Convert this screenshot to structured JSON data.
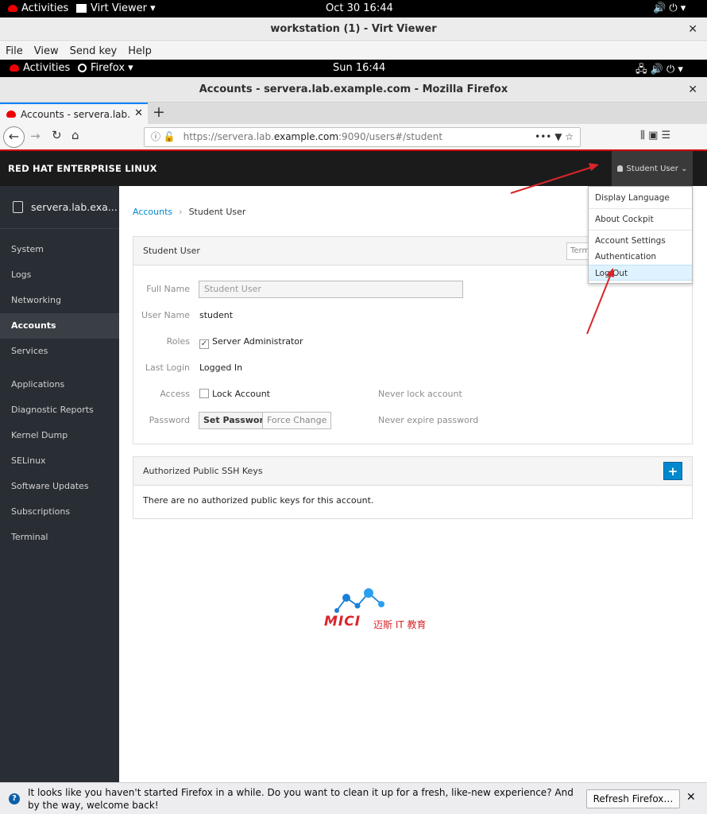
{
  "outer_bar": {
    "activities": "Activities",
    "app_menu": "Virt Viewer ▾",
    "clock": "Oct 30  16:44",
    "status_icons": "🔊  ⏻ ▾"
  },
  "virt_viewer": {
    "title": "workstation (1) - Virt Viewer",
    "close": "✕",
    "menu": [
      "File",
      "View",
      "Send key",
      "Help"
    ]
  },
  "inner_bar": {
    "activities": "Activities",
    "app_menu": "Firefox ▾",
    "clock": "Sun 16:44",
    "status_icons": "🖧  🔊  ⏻ ▾"
  },
  "firefox": {
    "title": "Accounts - servera.lab.example.com - Mozilla Firefox",
    "close": "✕",
    "tab_label": "Accounts - servera.lab.example.com",
    "tab_close": "✕",
    "new_tab": "+",
    "url_prefix": "https://servera.lab.",
    "url_host": "example.com",
    "url_suffix": ":9090/users#/student",
    "url_actions": "•••  ▼  ☆",
    "toolbar_right": "⫼  ▣  ☰"
  },
  "cockpit": {
    "brand": "RED HAT ENTERPRISE LINUX",
    "user_menu": "Student User ⌄",
    "host": "servera.lab.exa...",
    "nav_group1": [
      "System",
      "Logs",
      "Networking",
      "Accounts",
      "Services"
    ],
    "nav_group2": [
      "Applications",
      "Diagnostic Reports",
      "Kernel Dump",
      "SELinux",
      "Software Updates",
      "Subscriptions",
      "Terminal"
    ],
    "breadcrumb_link": "Accounts",
    "breadcrumb_sep": "›",
    "breadcrumb_current": "Student User",
    "user_panel": {
      "title": "Student User",
      "terminate_btn": "Term",
      "full_name_label": "Full Name",
      "full_name_value": "Student User",
      "user_name_label": "User Name",
      "user_name_value": "student",
      "roles_label": "Roles",
      "roles_value": "Server Administrator",
      "last_login_label": "Last Login",
      "last_login_value": "Logged In",
      "access_label": "Access",
      "lock_account": "Lock Account",
      "never_lock": "Never lock account",
      "password_label": "Password",
      "set_password": "Set Password",
      "force_change": "Force Change",
      "never_expire": "Never expire password"
    },
    "ssh_panel": {
      "title": "Authorized Public SSH Keys",
      "add_btn": "+",
      "empty_text": "There are no authorized public keys for this account."
    },
    "dropdown": [
      "Display Language",
      "About Cockpit",
      "Account Settings",
      "Authentication",
      "Log Out"
    ]
  },
  "logo": {
    "word": "MICI",
    "cn": "迈斯 IT 教育"
  },
  "notification": {
    "text": "It looks like you haven't started Firefox in a while. Do you want to clean it up for a fresh, like-new experience? And by the way, welcome back!",
    "button": "Refresh Firefox…",
    "close": "✕"
  },
  "colors": {
    "accent_blue": "#0088ce",
    "firefox_blue": "#0a84ff",
    "annotation_red": "#d9252a",
    "sidebar_bg": "#292e34"
  }
}
